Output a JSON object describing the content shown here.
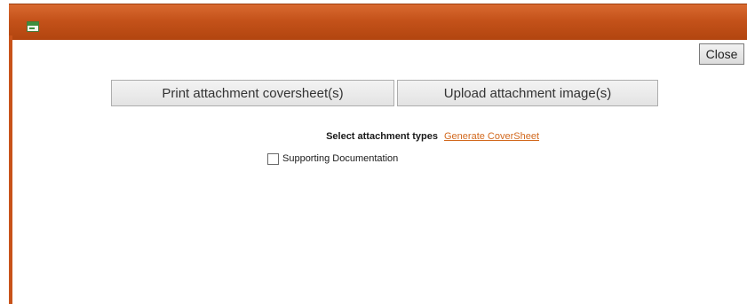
{
  "window": {
    "icon": "window-app-icon",
    "close_label": "Close"
  },
  "actions": {
    "print_label": "Print attachment coversheet(s)",
    "upload_label": "Upload attachment image(s)"
  },
  "attachment": {
    "select_label": "Select attachment types",
    "generate_link": "Generate CoverSheet",
    "types": [
      {
        "label": "Supporting Documentation",
        "checked": false
      }
    ]
  },
  "colors": {
    "titlebar": "#c4521a",
    "link": "#d2691e"
  }
}
